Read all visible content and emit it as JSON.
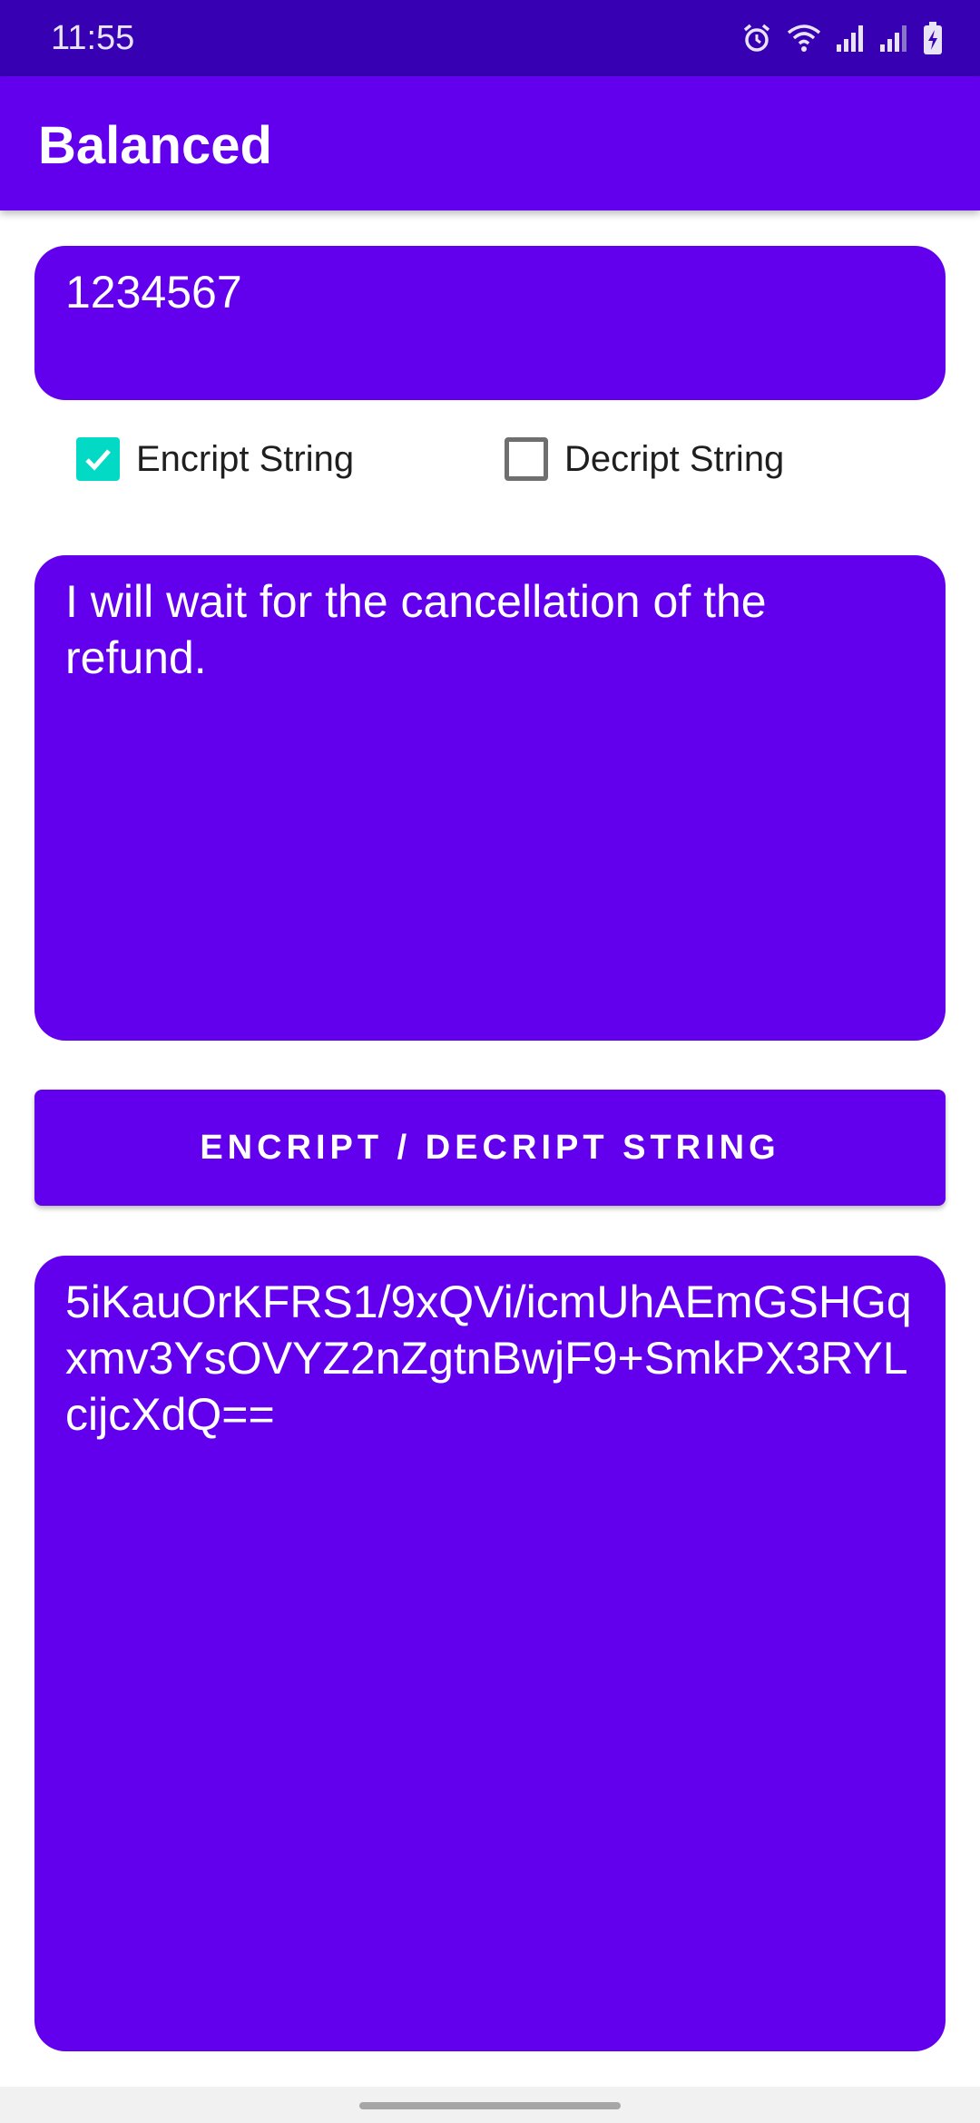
{
  "status_bar": {
    "time": "11:55",
    "icons": [
      "alarm-icon",
      "wifi-icon",
      "signal-icon",
      "signal-icon",
      "battery-charging-icon"
    ]
  },
  "app_bar": {
    "title": "Balanced"
  },
  "key_field": {
    "value": "1234567"
  },
  "options": {
    "encrypt": {
      "label": "Encript String",
      "checked": true
    },
    "decrypt": {
      "label": "Decript String",
      "checked": false
    }
  },
  "message_field": {
    "value": "I will wait for the cancellation of the refund."
  },
  "action_button": {
    "label": "ENCRIPT / DECRIPT STRING"
  },
  "result_field": {
    "value": "5iKauOrKFRS1/9xQVi/icmUhAEmGSHGqxmv3YsOVYZ2nZgtnBwjF9+SmkPX3RYLcijcXdQ=="
  },
  "colors": {
    "status_bar": "#3700b3",
    "primary": "#6200ee",
    "checkbox_accent": "#03dac5"
  }
}
